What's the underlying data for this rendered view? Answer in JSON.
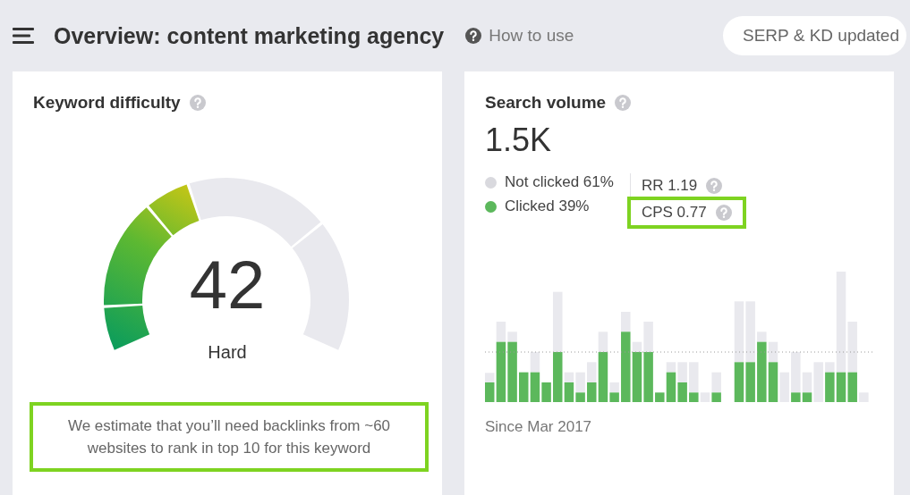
{
  "header": {
    "title": "Overview: content marketing agency",
    "help_link": "How to use",
    "status_pill": "SERP & KD updated"
  },
  "keyword_difficulty": {
    "title": "Keyword difficulty",
    "gauge": {
      "level": 0.42
    },
    "score": "42",
    "rating": "Hard",
    "note": {
      "text": "We estimate that you’ll need backlinks from ~60 websites to rank in top 10 for this keyword",
      "highlighted": true
    }
  },
  "search_volume": {
    "title": "Search volume",
    "value": "1.5K",
    "legend": [
      {
        "label": "Not clicked 61%",
        "color": "#d9d9de"
      },
      {
        "label": "Clicked 39%",
        "color": "#5cb85c"
      }
    ],
    "metrics": [
      {
        "label": "RR 1.19",
        "highlighted": false
      },
      {
        "label": "CPS 0.77",
        "highlighted": true
      }
    ],
    "footer": "Since Mar 2017"
  }
}
